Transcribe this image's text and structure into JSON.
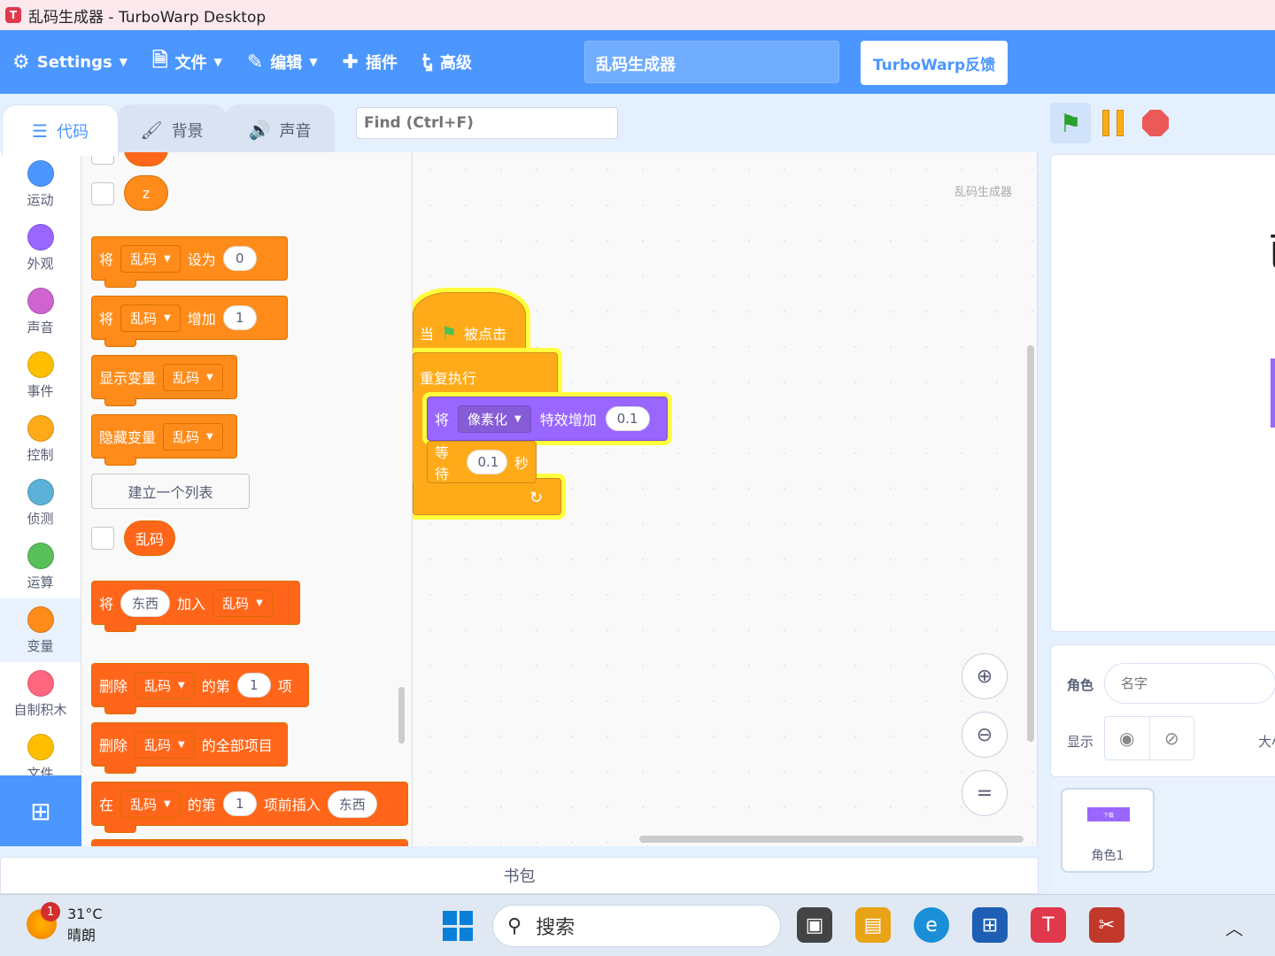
{
  "window": {
    "title": "乱码生成器 - TurboWarp Desktop"
  },
  "menubar": {
    "settings": "Settings",
    "file": "文件",
    "edit": "编辑",
    "addons": "插件",
    "advanced": "高级",
    "project_title": "乱码生成器",
    "feedback": "TurboWarp反馈"
  },
  "tabs": {
    "code": "代码",
    "backdrops": "背景",
    "sounds": "声音"
  },
  "find": {
    "placeholder": "Find (Ctrl+F)"
  },
  "categories": [
    {
      "label": "运动",
      "color": "#4c97ff"
    },
    {
      "label": "外观",
      "color": "#9966ff"
    },
    {
      "label": "声音",
      "color": "#cf63cf"
    },
    {
      "label": "事件",
      "color": "#ffbf00"
    },
    {
      "label": "控制",
      "color": "#ffab19"
    },
    {
      "label": "侦测",
      "color": "#5cb1d6"
    },
    {
      "label": "运算",
      "color": "#59c059"
    },
    {
      "label": "变量",
      "color": "#ff8c1a"
    },
    {
      "label": "自制积木",
      "color": "#ff6680"
    },
    {
      "label": "文件",
      "color": "#ffbf00"
    }
  ],
  "palette": {
    "var_z": "z",
    "set_block": {
      "word1": "将",
      "var": "乱码",
      "word2": "设为",
      "value": "0"
    },
    "change_block": {
      "word1": "将",
      "var": "乱码",
      "word2": "增加",
      "value": "1"
    },
    "show_var": {
      "word": "显示变量",
      "var": "乱码"
    },
    "hide_var": {
      "word": "隐藏变量",
      "var": "乱码"
    },
    "make_list": "建立一个列表",
    "list_reporter": "乱码",
    "add_to_list": {
      "word1": "将",
      "value": "东西",
      "word2": "加入",
      "list": "乱码"
    },
    "delete_item": {
      "word1": "删除",
      "list": "乱码",
      "word2": "的第",
      "value": "1",
      "word3": "项"
    },
    "delete_all": {
      "word1": "删除",
      "list": "乱码",
      "word2": "的全部项目"
    },
    "insert_at": {
      "word1": "在",
      "list": "乱码",
      "word2": "的第",
      "value": "1",
      "word3": "项前插入",
      "value2": "东西"
    }
  },
  "workspace": {
    "sprite_name": "乱码生成器",
    "hat": {
      "word1": "当",
      "word2": "被点击"
    },
    "forever": "重复执行",
    "effect": {
      "word1": "将",
      "effect": "像素化",
      "word2": "特效增加",
      "value": "0.1"
    },
    "wait": {
      "word1": "等待",
      "value": "0.1",
      "word2": "秒"
    }
  },
  "backpack": "书包",
  "stage": {
    "glyph": "已"
  },
  "sprite_info": {
    "sprite_label": "角色",
    "name_placeholder": "名字",
    "show_label": "显示",
    "size_label": "大小"
  },
  "sprites": [
    {
      "name": "角色1",
      "thumb_text": "下载"
    }
  ],
  "taskbar": {
    "badge": "1",
    "temperature": "31°C",
    "condition": "晴朗",
    "search_placeholder": "搜索"
  }
}
